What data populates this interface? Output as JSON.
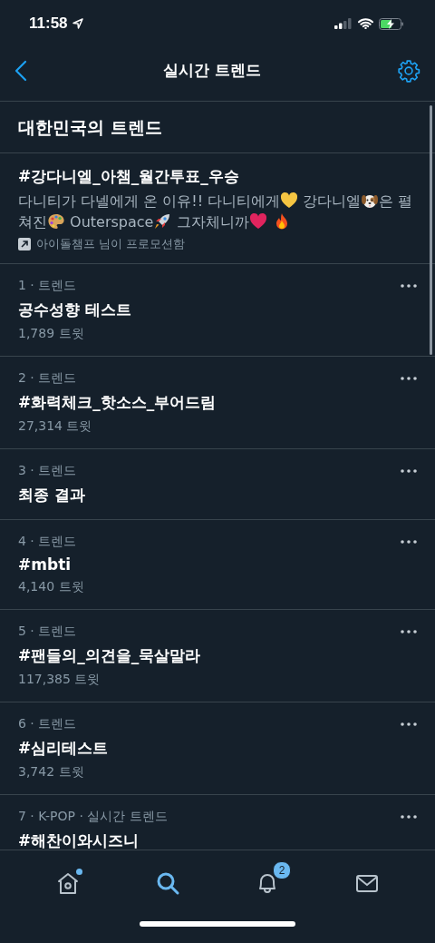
{
  "status_bar": {
    "time": "11:58"
  },
  "header": {
    "title": "실시간 트렌드"
  },
  "section_title": "대한민국의 트렌드",
  "promoted": {
    "hashtag": "#강다니엘_아챔_월간투표_우승",
    "description": [
      {
        "kind": "text",
        "text": "다니티가 다넬에게 온 이유!! 다니티에게"
      },
      {
        "kind": "heart",
        "color": "#f5c542"
      },
      {
        "kind": "text",
        "text": " 강다니엘"
      },
      {
        "kind": "dog"
      },
      {
        "kind": "text",
        "text": "은 펼쳐진"
      },
      {
        "kind": "palette"
      },
      {
        "kind": "text",
        "text": " Outerspace"
      },
      {
        "kind": "rocket"
      },
      {
        "kind": "text",
        "text": " 그자체니까"
      },
      {
        "kind": "heart",
        "color": "#e0245e"
      },
      {
        "kind": "fire"
      }
    ],
    "promoter": "아이돌챔프 님이 프로모션함"
  },
  "trends": [
    {
      "context": "1 · 트렌드",
      "name": "공수성향 테스트",
      "count": "1,789 트윗"
    },
    {
      "context": "2 · 트렌드",
      "name": "#화력체크_핫소스_부어드림",
      "count": "27,314 트윗"
    },
    {
      "context": "3 · 트렌드",
      "name": "최종 결과"
    },
    {
      "context": "4 · 트렌드",
      "name": "#mbti",
      "count": "4,140 트윗"
    },
    {
      "context": "5 · 트렌드",
      "name": "#팬들의_의견을_묵살말라",
      "count": "117,385 트윗"
    },
    {
      "context": "6 · 트렌드",
      "name": "#심리테스트",
      "count": "3,742 트윗"
    },
    {
      "context": "7 · K-POP · 실시간 트렌드",
      "name": "#해찬이와시즈니"
    }
  ],
  "tab_bar": [
    {
      "kind": "home",
      "selected": false,
      "dot": true
    },
    {
      "kind": "search",
      "selected": true
    },
    {
      "kind": "bell",
      "selected": false,
      "badge": "2"
    },
    {
      "kind": "mail",
      "selected": false
    }
  ]
}
